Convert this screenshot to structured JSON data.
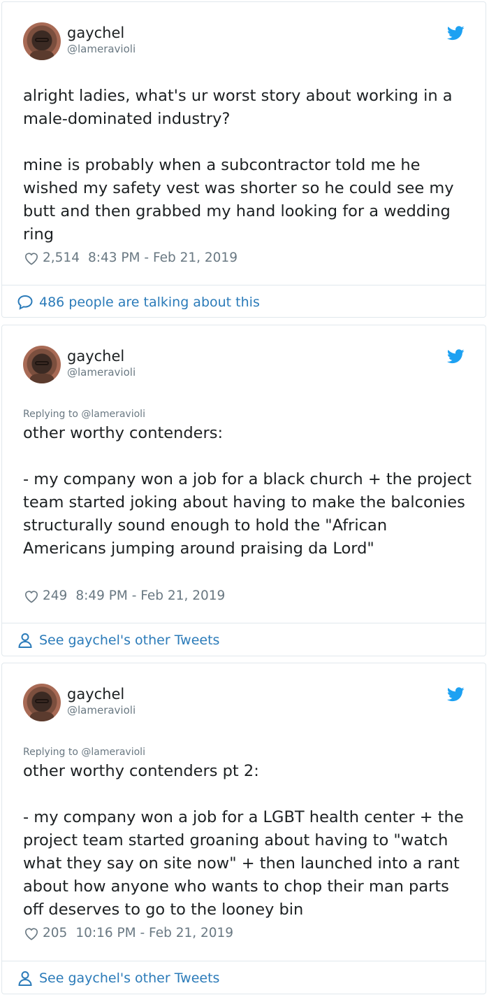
{
  "tweets": [
    {
      "name": "gaychel",
      "handle": "@lameravioli",
      "reply_to": "",
      "text": "alright ladies, what's ur worst story about working in a male-dominated industry?\n\nmine is probably when a subcontractor told me he wished my safety vest was shorter so he could see my butt and then grabbed my hand looking for a wedding ring",
      "likes": "2,514",
      "timestamp": "8:43 PM - Feb 21, 2019",
      "footer": "486 people are talking about this",
      "footer_icon": "speech-bubble-icon"
    },
    {
      "name": "gaychel",
      "handle": "@lameravioli",
      "reply_to": "Replying to @lameravioli",
      "text": "other worthy contenders:\n\n- my company won a job for a black church + the project team started joking about having to make the balconies structurally sound enough to hold the \"African Americans jumping around praising da Lord\"",
      "likes": "249",
      "timestamp": "8:49 PM - Feb 21, 2019",
      "footer": "See gaychel's other Tweets",
      "footer_icon": "person-icon"
    },
    {
      "name": "gaychel",
      "handle": "@lameravioli",
      "reply_to": "Replying to @lameravioli",
      "text": "other worthy contenders pt 2:\n\n- my company won a job for a LGBT health center + the project team started groaning about having to \"watch what they say on site now\" + then launched into a rant about how anyone who wants to chop their man parts off deserves to go to the looney bin",
      "likes": "205",
      "timestamp": "10:16 PM - Feb 21, 2019",
      "footer": "See gaychel's other Tweets",
      "footer_icon": "person-icon"
    }
  ],
  "colors": {
    "link": "#2b7bb9",
    "twitter_bird": "#1da1f2",
    "muted": "#697882",
    "text": "#1c2022",
    "border": "#e1e8ed"
  }
}
